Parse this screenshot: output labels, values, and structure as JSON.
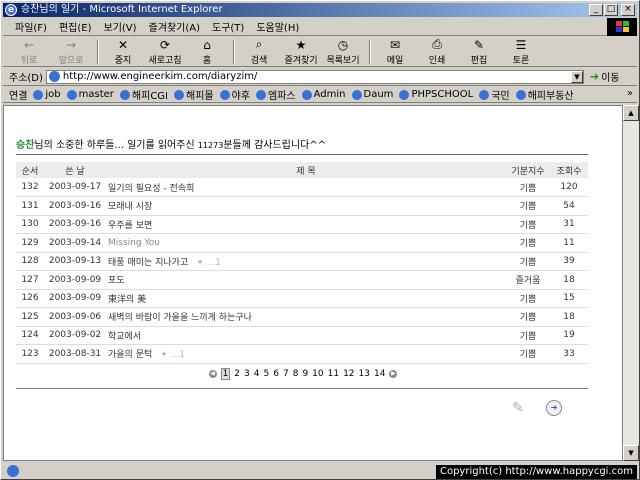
{
  "window": {
    "title": "승찬님의 일기 - Microsoft Internet Explorer",
    "buttons": [
      "_",
      "□",
      "×"
    ]
  },
  "menubar": [
    "파일(F)",
    "편집(E)",
    "보기(V)",
    "즐겨찾기(A)",
    "도구(T)",
    "도움말(H)"
  ],
  "toolbar": [
    {
      "label": "뒤로",
      "icon": "←",
      "disabled": true
    },
    {
      "label": "앞으로",
      "icon": "→",
      "disabled": true
    },
    {
      "label": "중지",
      "icon": "✕",
      "disabled": false
    },
    {
      "label": "새로고침",
      "icon": "⟳",
      "disabled": false
    },
    {
      "label": "홈",
      "icon": "⌂",
      "disabled": false
    },
    {
      "label": "검색",
      "icon": "⌕",
      "disabled": false
    },
    {
      "label": "즐겨찾기",
      "icon": "★",
      "disabled": false
    },
    {
      "label": "목록보기",
      "icon": "◷",
      "disabled": false
    },
    {
      "label": "메일",
      "icon": "✉",
      "disabled": false
    },
    {
      "label": "인쇄",
      "icon": "⎙",
      "disabled": false
    },
    {
      "label": "편집",
      "icon": "✎",
      "disabled": false
    },
    {
      "label": "토론",
      "icon": "☰",
      "disabled": false
    }
  ],
  "address": {
    "label": "주소(D)",
    "url": "http://www.engineerkim.com/diaryzim/",
    "go_label": "이동"
  },
  "links": {
    "label": "연결",
    "items": [
      "job",
      "master",
      "해피CGI",
      "해피몰",
      "야후",
      "엠파스",
      "Admin",
      "Daum",
      "PHPSCHOOL",
      "국민",
      "해피부동산"
    ],
    "more": "»"
  },
  "page": {
    "greeting_name": "승찬",
    "greeting_text": "님의 소중한 하루들... 일기를 읽어주신 ",
    "visitor_count": "11273",
    "greeting_tail": "분들께 감사드립니다^^",
    "table_headers": [
      "순서",
      "쓴 날",
      "제 목",
      "기분지수",
      "조회수"
    ],
    "entries": [
      {
        "no": "132",
        "date": "2003-09-17",
        "title": "일기의 필요성 - 전속희",
        "tail": "",
        "muted": false,
        "mood": "기쁨",
        "views": "120"
      },
      {
        "no": "131",
        "date": "2003-09-16",
        "title": "모래내 시장",
        "tail": "",
        "muted": false,
        "mood": "기쁨",
        "views": "54"
      },
      {
        "no": "130",
        "date": "2003-09-16",
        "title": "우주를 보면",
        "tail": "",
        "muted": false,
        "mood": "기쁨",
        "views": "31"
      },
      {
        "no": "129",
        "date": "2003-09-14",
        "title": "Missing You",
        "tail": "",
        "muted": true,
        "mood": "기쁨",
        "views": "11"
      },
      {
        "no": "128",
        "date": "2003-09-13",
        "title": "태풍 매미는 지나가고",
        "tail": "✦ ...1",
        "muted": false,
        "mood": "기쁨",
        "views": "39"
      },
      {
        "no": "127",
        "date": "2003-09-09",
        "title": "포도",
        "tail": "",
        "muted": false,
        "mood": "즐거움",
        "views": "18"
      },
      {
        "no": "126",
        "date": "2003-09-09",
        "title": "東洋의 美",
        "tail": "",
        "muted": false,
        "mood": "기쁨",
        "views": "15"
      },
      {
        "no": "125",
        "date": "2003-09-06",
        "title": "새벽의 바람이 가을을 느끼게 하는구나",
        "tail": "",
        "muted": false,
        "mood": "기쁨",
        "views": "18"
      },
      {
        "no": "124",
        "date": "2003-09-02",
        "title": "학교에서",
        "tail": "",
        "muted": false,
        "mood": "기쁨",
        "views": "19"
      },
      {
        "no": "123",
        "date": "2003-08-31",
        "title": "가을의 문턱",
        "tail": "✦ ...1",
        "muted": false,
        "mood": "기쁨",
        "views": "33"
      }
    ],
    "pages": [
      "1",
      "2",
      "3",
      "4",
      "5",
      "6",
      "7",
      "8",
      "9",
      "10",
      "11",
      "12",
      "13",
      "14"
    ],
    "current_page": "1"
  },
  "status": {
    "copyright": "Copyright(c) http://www.happycgi.com"
  }
}
